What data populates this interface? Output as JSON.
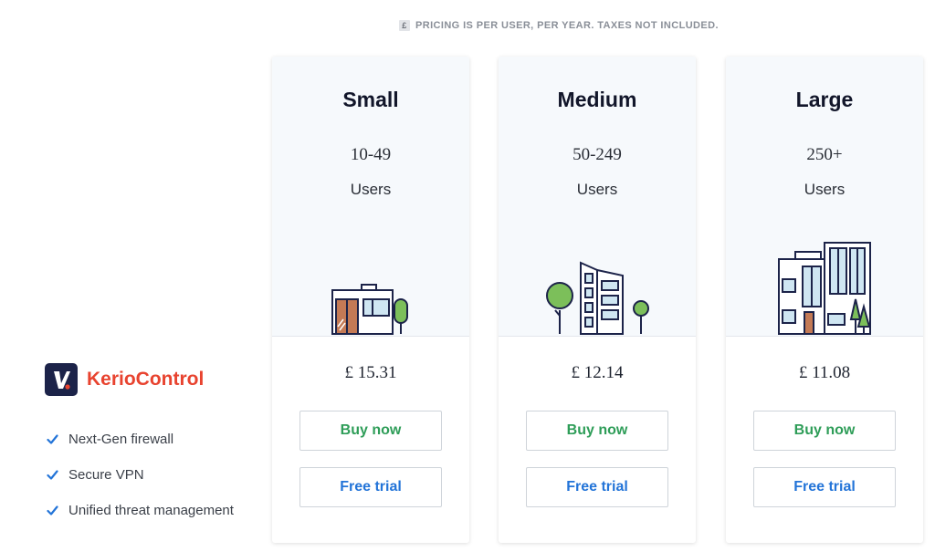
{
  "notice": {
    "currency_icon": "£",
    "text": "PRICING IS PER USER, PER YEAR. TAXES NOT INCLUDED."
  },
  "product": {
    "name": "KerioControl",
    "logo_icon": "kerio-logo-icon",
    "features": [
      "Next-Gen firewall",
      "Secure VPN",
      "Unified threat management"
    ]
  },
  "plans": [
    {
      "tier": "Small",
      "range": "10-49",
      "unit": "Users",
      "price": "£ 15.31",
      "buy_label": "Buy now",
      "trial_label": "Free trial",
      "illustration": "small-building-icon"
    },
    {
      "tier": "Medium",
      "range": "50-249",
      "unit": "Users",
      "price": "£ 12.14",
      "buy_label": "Buy now",
      "trial_label": "Free trial",
      "illustration": "medium-building-icon"
    },
    {
      "tier": "Large",
      "range": "250+",
      "unit": "Users",
      "price": "£ 11.08",
      "buy_label": "Buy now",
      "trial_label": "Free trial",
      "illustration": "large-building-icon"
    }
  ],
  "colors": {
    "buy": "#2e9d58",
    "trial": "#2374d8",
    "brand": "#e8432f",
    "logo_bg": "#1c2349",
    "card_top": "#f6f9fc"
  }
}
